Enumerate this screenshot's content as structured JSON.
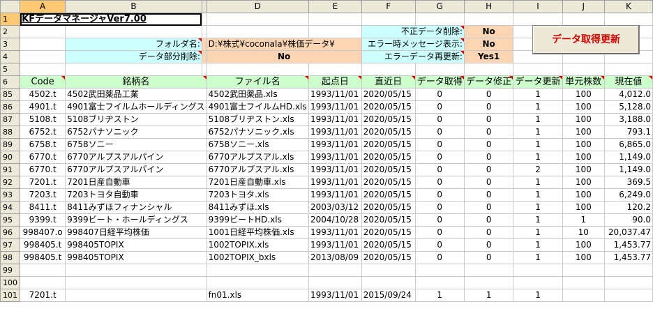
{
  "columns": [
    "A",
    "B",
    "C",
    "D",
    "E",
    "F",
    "G",
    "H",
    "I",
    "J",
    "K"
  ],
  "title": "KFデータマネージャVer7.00",
  "settings": {
    "folder_label": "フォルダ名:",
    "folder_value": "D:¥株式¥coconala¥株価データ¥",
    "delete_label": "データ部分削除:",
    "delete_value": "No",
    "invalid_label": "不正データ削除:",
    "invalid_value": "No",
    "errmsg_label": "エラー時メッセージ表示:",
    "errmsg_value": "No",
    "reupdate_label": "エラーデータ再更新:",
    "reupdate_value": "Yes1"
  },
  "button_label": "データ取得更新",
  "headers": [
    "Code",
    "銘柄名",
    "ファイル名",
    "起点日",
    "直近日",
    "データ取得",
    "データ修正",
    "データ更新",
    "単元株数",
    "現在値"
  ],
  "top_rows": [
    "1",
    "2",
    "3",
    "4",
    "5",
    "6"
  ],
  "rows": [
    {
      "row": "85",
      "code": "4502.t",
      "name": "4502武田薬品工業",
      "file": "4502武田薬品.xls",
      "start": "1993/11/01",
      "last": "2020/05/15",
      "get": "0",
      "fix": "0",
      "upd": "1",
      "unit": "100",
      "price": "4,012.0"
    },
    {
      "row": "86",
      "code": "4901.t",
      "name": "4901富士フイルムホールディングス",
      "file": "4901富士フイルムHD.xls",
      "start": "1993/11/01",
      "last": "2020/05/15",
      "get": "0",
      "fix": "0",
      "upd": "1",
      "unit": "100",
      "price": "5,128.0"
    },
    {
      "row": "87",
      "code": "5108.t",
      "name": "5108ブリヂストン",
      "file": "5108ブリヂストン.xls",
      "start": "1993/11/01",
      "last": "2020/05/15",
      "get": "0",
      "fix": "0",
      "upd": "1",
      "unit": "100",
      "price": "3,188.0"
    },
    {
      "row": "88",
      "code": "6752.t",
      "name": "6752パナソニック",
      "file": "6752パナソニック.xls",
      "start": "1993/11/01",
      "last": "2020/05/15",
      "get": "0",
      "fix": "0",
      "upd": "1",
      "unit": "100",
      "price": "793.1"
    },
    {
      "row": "89",
      "code": "6758.t",
      "name": "6758ソニー",
      "file": "6758ソニー.xls",
      "start": "1993/11/01",
      "last": "2020/05/15",
      "get": "0",
      "fix": "0",
      "upd": "1",
      "unit": "100",
      "price": "6,865.0"
    },
    {
      "row": "90",
      "code": "6770.t",
      "name": "6770アルプスアルパイン",
      "file": "6770アルプスアル.xls",
      "start": "1993/11/01",
      "last": "2020/05/15",
      "get": "0",
      "fix": "0",
      "upd": "1",
      "unit": "100",
      "price": "1,149.0"
    },
    {
      "row": "91",
      "code": "6770.t",
      "name": "6770アルプスアルパイン",
      "file": "6770アルプスアル.xls",
      "start": "1993/11/01",
      "last": "2020/05/15",
      "get": "0",
      "fix": "0",
      "upd": "2",
      "unit": "100",
      "price": "1,149.0"
    },
    {
      "row": "92",
      "code": "7201.t",
      "name": "7201日産自動車",
      "file": "7201日産自動車.xls",
      "start": "1993/11/01",
      "last": "2020/05/15",
      "get": "0",
      "fix": "0",
      "upd": "1",
      "unit": "100",
      "price": "369.5"
    },
    {
      "row": "93",
      "code": "7203.t",
      "name": "7203トヨタ自動車",
      "file": "7203トヨタ.xls",
      "start": "1993/11/01",
      "last": "2020/05/15",
      "get": "0",
      "fix": "0",
      "upd": "1",
      "unit": "100",
      "price": "6,249.0"
    },
    {
      "row": "94",
      "code": "8411.t",
      "name": "8411みずほフィナンシャル",
      "file": "8411みずほ.xls",
      "start": "2003/03/12",
      "last": "2020/05/15",
      "get": "0",
      "fix": "0",
      "upd": "1",
      "unit": "100",
      "price": "120.2"
    },
    {
      "row": "95",
      "code": "9399.t",
      "name": "9399ビート・ホールディングス",
      "file": "9399ビートHD.xls",
      "start": "2004/10/28",
      "last": "2020/05/15",
      "get": "0",
      "fix": "0",
      "upd": "1",
      "unit": "1",
      "price": "90.0"
    },
    {
      "row": "96",
      "code": "998407.o",
      "name": "998407日経平均株価",
      "file": "1001日経平均株価.xls",
      "start": "1993/11/01",
      "last": "2020/05/15",
      "get": "0",
      "fix": "0",
      "upd": "1",
      "unit": "10",
      "price": "20,037.47"
    },
    {
      "row": "97",
      "code": "998405.t",
      "name": "998405TOPIX",
      "file": "1002TOPIX.xls",
      "start": "1993/11/01",
      "last": "2020/05/15",
      "get": "0",
      "fix": "0",
      "upd": "1",
      "unit": "100",
      "price": "1,453.77"
    },
    {
      "row": "98",
      "code": "998405.t",
      "name": "998405TOPIX",
      "file": "1002TOPIX_bxls",
      "start": "2013/08/09",
      "last": "2020/05/15",
      "get": "0",
      "fix": "0",
      "upd": "1",
      "unit": "100",
      "price": "1,453.77"
    },
    {
      "row": "99",
      "code": "",
      "name": "",
      "file": "",
      "start": "",
      "last": "",
      "get": "",
      "fix": "",
      "upd": "",
      "unit": "",
      "price": ""
    },
    {
      "row": "100",
      "code": "",
      "name": "",
      "file": "",
      "start": "",
      "last": "",
      "get": "",
      "fix": "",
      "upd": "",
      "unit": "",
      "price": ""
    },
    {
      "row": "101",
      "code": "7201.t",
      "name": "",
      "file": "fn01.xls",
      "start": "1993/11/01",
      "last": "2015/09/24",
      "get": "1",
      "fix": "1",
      "upd": "1",
      "unit": "",
      "price": ""
    }
  ]
}
